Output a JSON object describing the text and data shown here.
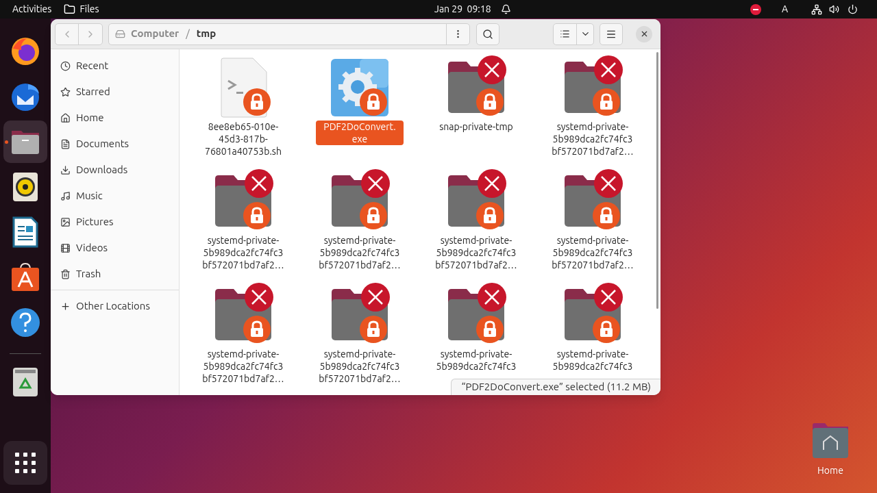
{
  "top_bar": {
    "activities": "Activities",
    "app": "Files",
    "date": "Jan 29",
    "time": "09:18",
    "input_source": "A"
  },
  "dock": [
    {
      "kind": "firefox",
      "running": false
    },
    {
      "kind": "thunderbird",
      "running": false
    },
    {
      "kind": "files",
      "running": true
    },
    {
      "kind": "rhythmbox",
      "running": false
    },
    {
      "kind": "writer",
      "running": false
    },
    {
      "kind": "software",
      "running": false
    },
    {
      "kind": "help",
      "running": false
    },
    {
      "kind": "trash",
      "running": false
    }
  ],
  "window": {
    "path": [
      "Computer",
      "tmp"
    ],
    "separator": "/"
  },
  "sidebar": {
    "items": [
      {
        "kind": "recent",
        "label": "Recent"
      },
      {
        "kind": "starred",
        "label": "Starred"
      },
      {
        "kind": "home",
        "label": "Home"
      },
      {
        "kind": "documents",
        "label": "Documents"
      },
      {
        "kind": "downloads",
        "label": "Downloads"
      },
      {
        "kind": "music",
        "label": "Music"
      },
      {
        "kind": "pictures",
        "label": "Pictures"
      },
      {
        "kind": "videos",
        "label": "Videos"
      },
      {
        "kind": "trash",
        "label": "Trash"
      }
    ],
    "other": {
      "label": "Other Locations"
    }
  },
  "files": [
    {
      "kind": "script",
      "label": [
        "8ee8eb65-010e-",
        "45d3-817b-",
        "76801a40753b.sh"
      ],
      "selected": false,
      "locked": true,
      "unreadable": false
    },
    {
      "kind": "executable",
      "label": [
        "PDF2DoConvert.",
        "exe"
      ],
      "selected": true,
      "locked": true,
      "unreadable": false
    },
    {
      "kind": "folder",
      "label": [
        "snap-private-tmp"
      ],
      "selected": false,
      "locked": true,
      "unreadable": true
    },
    {
      "kind": "folder",
      "label": [
        "systemd-private-",
        "5b989dca2fc74fc3",
        "bf572071bd7af2…"
      ],
      "selected": false,
      "locked": true,
      "unreadable": true
    },
    {
      "kind": "folder",
      "label": [
        "systemd-private-",
        "5b989dca2fc74fc3",
        "bf572071bd7af2…"
      ],
      "selected": false,
      "locked": true,
      "unreadable": true
    },
    {
      "kind": "folder",
      "label": [
        "systemd-private-",
        "5b989dca2fc74fc3",
        "bf572071bd7af2…"
      ],
      "selected": false,
      "locked": true,
      "unreadable": true
    },
    {
      "kind": "folder",
      "label": [
        "systemd-private-",
        "5b989dca2fc74fc3",
        "bf572071bd7af2…"
      ],
      "selected": false,
      "locked": true,
      "unreadable": true
    },
    {
      "kind": "folder",
      "label": [
        "systemd-private-",
        "5b989dca2fc74fc3",
        "bf572071bd7af2…"
      ],
      "selected": false,
      "locked": true,
      "unreadable": true
    },
    {
      "kind": "folder",
      "label": [
        "systemd-private-",
        "5b989dca2fc74fc3",
        "bf572071bd7af2…"
      ],
      "selected": false,
      "locked": true,
      "unreadable": true
    },
    {
      "kind": "folder",
      "label": [
        "systemd-private-",
        "5b989dca2fc74fc3",
        "bf572071bd7af2…"
      ],
      "selected": false,
      "locked": true,
      "unreadable": true
    },
    {
      "kind": "folder",
      "label": [
        "systemd-private-",
        "5b989dca2fc74fc3"
      ],
      "selected": false,
      "locked": true,
      "unreadable": true
    },
    {
      "kind": "folder",
      "label": [
        "systemd-private-",
        "5b989dca2fc74fc3"
      ],
      "selected": false,
      "locked": true,
      "unreadable": true
    }
  ],
  "status": "“PDF2DoConvert.exe” selected (11.2 MB)",
  "desktop": [
    {
      "label": "Home"
    }
  ]
}
